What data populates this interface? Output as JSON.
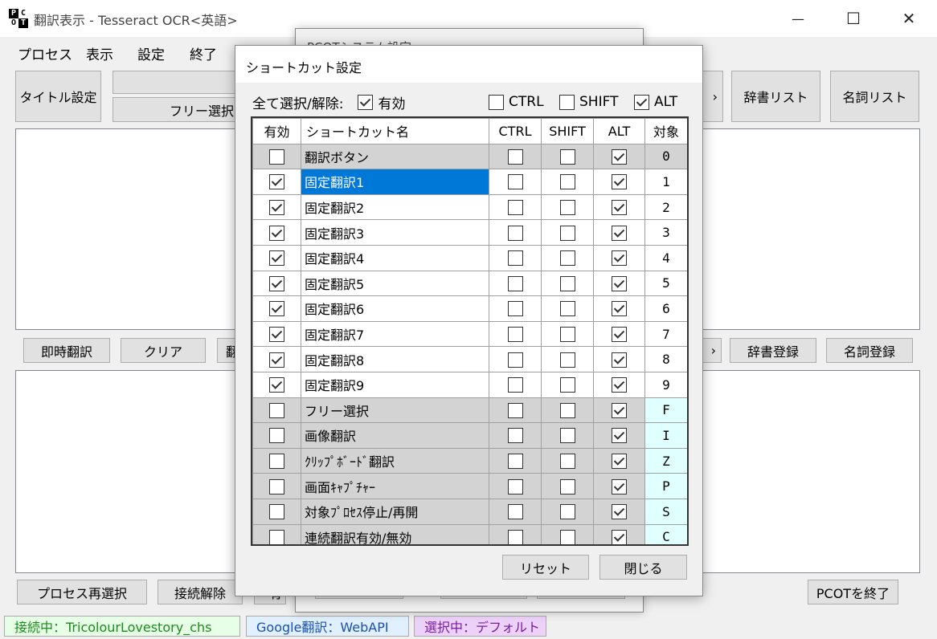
{
  "window": {
    "title": "翻訳表示 - Tesseract OCR<英語>",
    "icon_letters": [
      "P",
      "C",
      "O",
      "T"
    ],
    "minimize_glyph": "—",
    "maximize_glyph": "☐",
    "close_glyph": "✕"
  },
  "menu": [
    "プロセス",
    "表示",
    "設定",
    "終了"
  ],
  "main": {
    "title_setting": "タイトル設定",
    "free_select": "フリー選択",
    "dict_list": "辞書リスト",
    "noun_list": "名詞リスト",
    "instant_translate": "即時翻訳",
    "clear": "クリア",
    "translate_partial": "翻",
    "dict_register": "辞書登録",
    "noun_register": "名詞登録",
    "partial_right": "›",
    "process_reselect": "プロセス再選択",
    "disconnect": "接続解除",
    "bottom_partial": "有",
    "exit_pcot": "PCOTを終了"
  },
  "status": {
    "connected": "接続中：TricolourLovestory_chs",
    "engine": "Google翻訳：WebAPI",
    "selecting": "選択中：デフォルト"
  },
  "back_dialog": {
    "title": "PCOTシステム設定"
  },
  "dialog": {
    "title": "ショートカット設定",
    "select_all_label": "全て選択/解除:",
    "enabled_label": "有効",
    "ctrl_label": "CTRL",
    "shift_label": "SHIFT",
    "alt_label": "ALT",
    "reset": "リセット",
    "close": "閉じる",
    "headers": [
      "有効",
      "ショートカット名",
      "CTRL",
      "SHIFT",
      "ALT",
      "対象"
    ],
    "rows": [
      {
        "enabled": false,
        "name": "翻訳ボタン",
        "ctrl": false,
        "shift": false,
        "alt": true,
        "key": "0"
      },
      {
        "enabled": true,
        "name": "固定翻訳1",
        "ctrl": false,
        "shift": false,
        "alt": true,
        "key": "1"
      },
      {
        "enabled": true,
        "name": "固定翻訳2",
        "ctrl": false,
        "shift": false,
        "alt": true,
        "key": "2"
      },
      {
        "enabled": true,
        "name": "固定翻訳3",
        "ctrl": false,
        "shift": false,
        "alt": true,
        "key": "3"
      },
      {
        "enabled": true,
        "name": "固定翻訳4",
        "ctrl": false,
        "shift": false,
        "alt": true,
        "key": "4"
      },
      {
        "enabled": true,
        "name": "固定翻訳5",
        "ctrl": false,
        "shift": false,
        "alt": true,
        "key": "5"
      },
      {
        "enabled": true,
        "name": "固定翻訳6",
        "ctrl": false,
        "shift": false,
        "alt": true,
        "key": "6"
      },
      {
        "enabled": true,
        "name": "固定翻訳7",
        "ctrl": false,
        "shift": false,
        "alt": true,
        "key": "7"
      },
      {
        "enabled": true,
        "name": "固定翻訳8",
        "ctrl": false,
        "shift": false,
        "alt": true,
        "key": "8"
      },
      {
        "enabled": true,
        "name": "固定翻訳9",
        "ctrl": false,
        "shift": false,
        "alt": true,
        "key": "9"
      },
      {
        "enabled": false,
        "name": "フリー選択",
        "ctrl": false,
        "shift": false,
        "alt": true,
        "key": "F"
      },
      {
        "enabled": false,
        "name": "画像翻訳",
        "ctrl": false,
        "shift": false,
        "alt": true,
        "key": "I"
      },
      {
        "enabled": false,
        "name": "ｸﾘｯﾌﾟﾎﾞｰﾄﾞ翻訳",
        "ctrl": false,
        "shift": false,
        "alt": true,
        "key": "Z"
      },
      {
        "enabled": false,
        "name": "画面ｷｬﾌﾟﾁｬｰ",
        "ctrl": false,
        "shift": false,
        "alt": true,
        "key": "P"
      },
      {
        "enabled": false,
        "name": "対象ﾌﾟﾛｾｽ停止/再開",
        "ctrl": false,
        "shift": false,
        "alt": true,
        "key": "S"
      },
      {
        "enabled": false,
        "name": "連続翻訳有効/無効",
        "ctrl": false,
        "shift": false,
        "alt": true,
        "key": "C"
      }
    ]
  },
  "colors": {
    "selection": "#0078d7",
    "key_cell_highlight": "#e0ffff",
    "status_connected_bg": "#e6ffe6",
    "status_connected_fg": "#1c8c1c",
    "status_engine_bg": "#e0f0ff",
    "status_engine_fg": "#1a50b0",
    "status_selecting_bg": "#ecd2f8",
    "status_selecting_fg": "#7a1aa8"
  }
}
